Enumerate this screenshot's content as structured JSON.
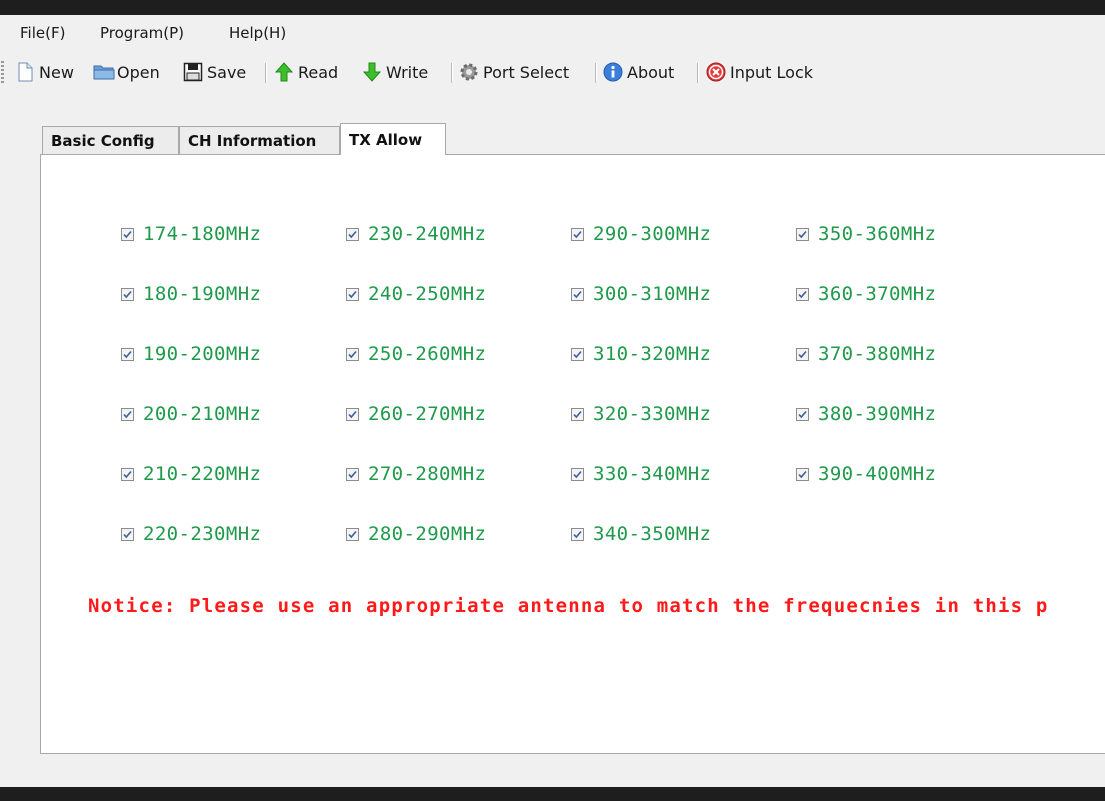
{
  "menu": [
    "File(F)",
    "Program(P)",
    "Help(H)"
  ],
  "toolbar": {
    "new_label": "New",
    "open_label": "Open",
    "save_label": "Save",
    "read_label": "Read",
    "write_label": "Write",
    "port_select_label": "Port Select",
    "about_label": "About",
    "input_lock_label": "Input Lock"
  },
  "tabs": [
    {
      "label": "Basic Config",
      "active": false
    },
    {
      "label": "CH Information",
      "active": false
    },
    {
      "label": "TX Allow",
      "active": true
    }
  ],
  "tx_allow": {
    "columns": [
      [
        {
          "label": "174-180MHz",
          "checked": true
        },
        {
          "label": "180-190MHz",
          "checked": true
        },
        {
          "label": "190-200MHz",
          "checked": true
        },
        {
          "label": "200-210MHz",
          "checked": true
        },
        {
          "label": "210-220MHz",
          "checked": true
        },
        {
          "label": "220-230MHz",
          "checked": true
        }
      ],
      [
        {
          "label": "230-240MHz",
          "checked": true
        },
        {
          "label": "240-250MHz",
          "checked": true
        },
        {
          "label": "250-260MHz",
          "checked": true
        },
        {
          "label": "260-270MHz",
          "checked": true
        },
        {
          "label": "270-280MHz",
          "checked": true
        },
        {
          "label": "280-290MHz",
          "checked": true
        }
      ],
      [
        {
          "label": "290-300MHz",
          "checked": true
        },
        {
          "label": "300-310MHz",
          "checked": true
        },
        {
          "label": "310-320MHz",
          "checked": true
        },
        {
          "label": "320-330MHz",
          "checked": true
        },
        {
          "label": "330-340MHz",
          "checked": true
        },
        {
          "label": "340-350MHz",
          "checked": true
        }
      ],
      [
        {
          "label": "350-360MHz",
          "checked": true
        },
        {
          "label": "360-370MHz",
          "checked": true
        },
        {
          "label": "370-380MHz",
          "checked": true
        },
        {
          "label": "380-390MHz",
          "checked": true
        },
        {
          "label": "390-400MHz",
          "checked": true
        }
      ]
    ],
    "notice": "Notice: Please use an appropriate antenna to match the frequecnies in this p"
  },
  "colors": {
    "label_green": "#1f9a4a",
    "notice_red": "#ff1a1a"
  }
}
